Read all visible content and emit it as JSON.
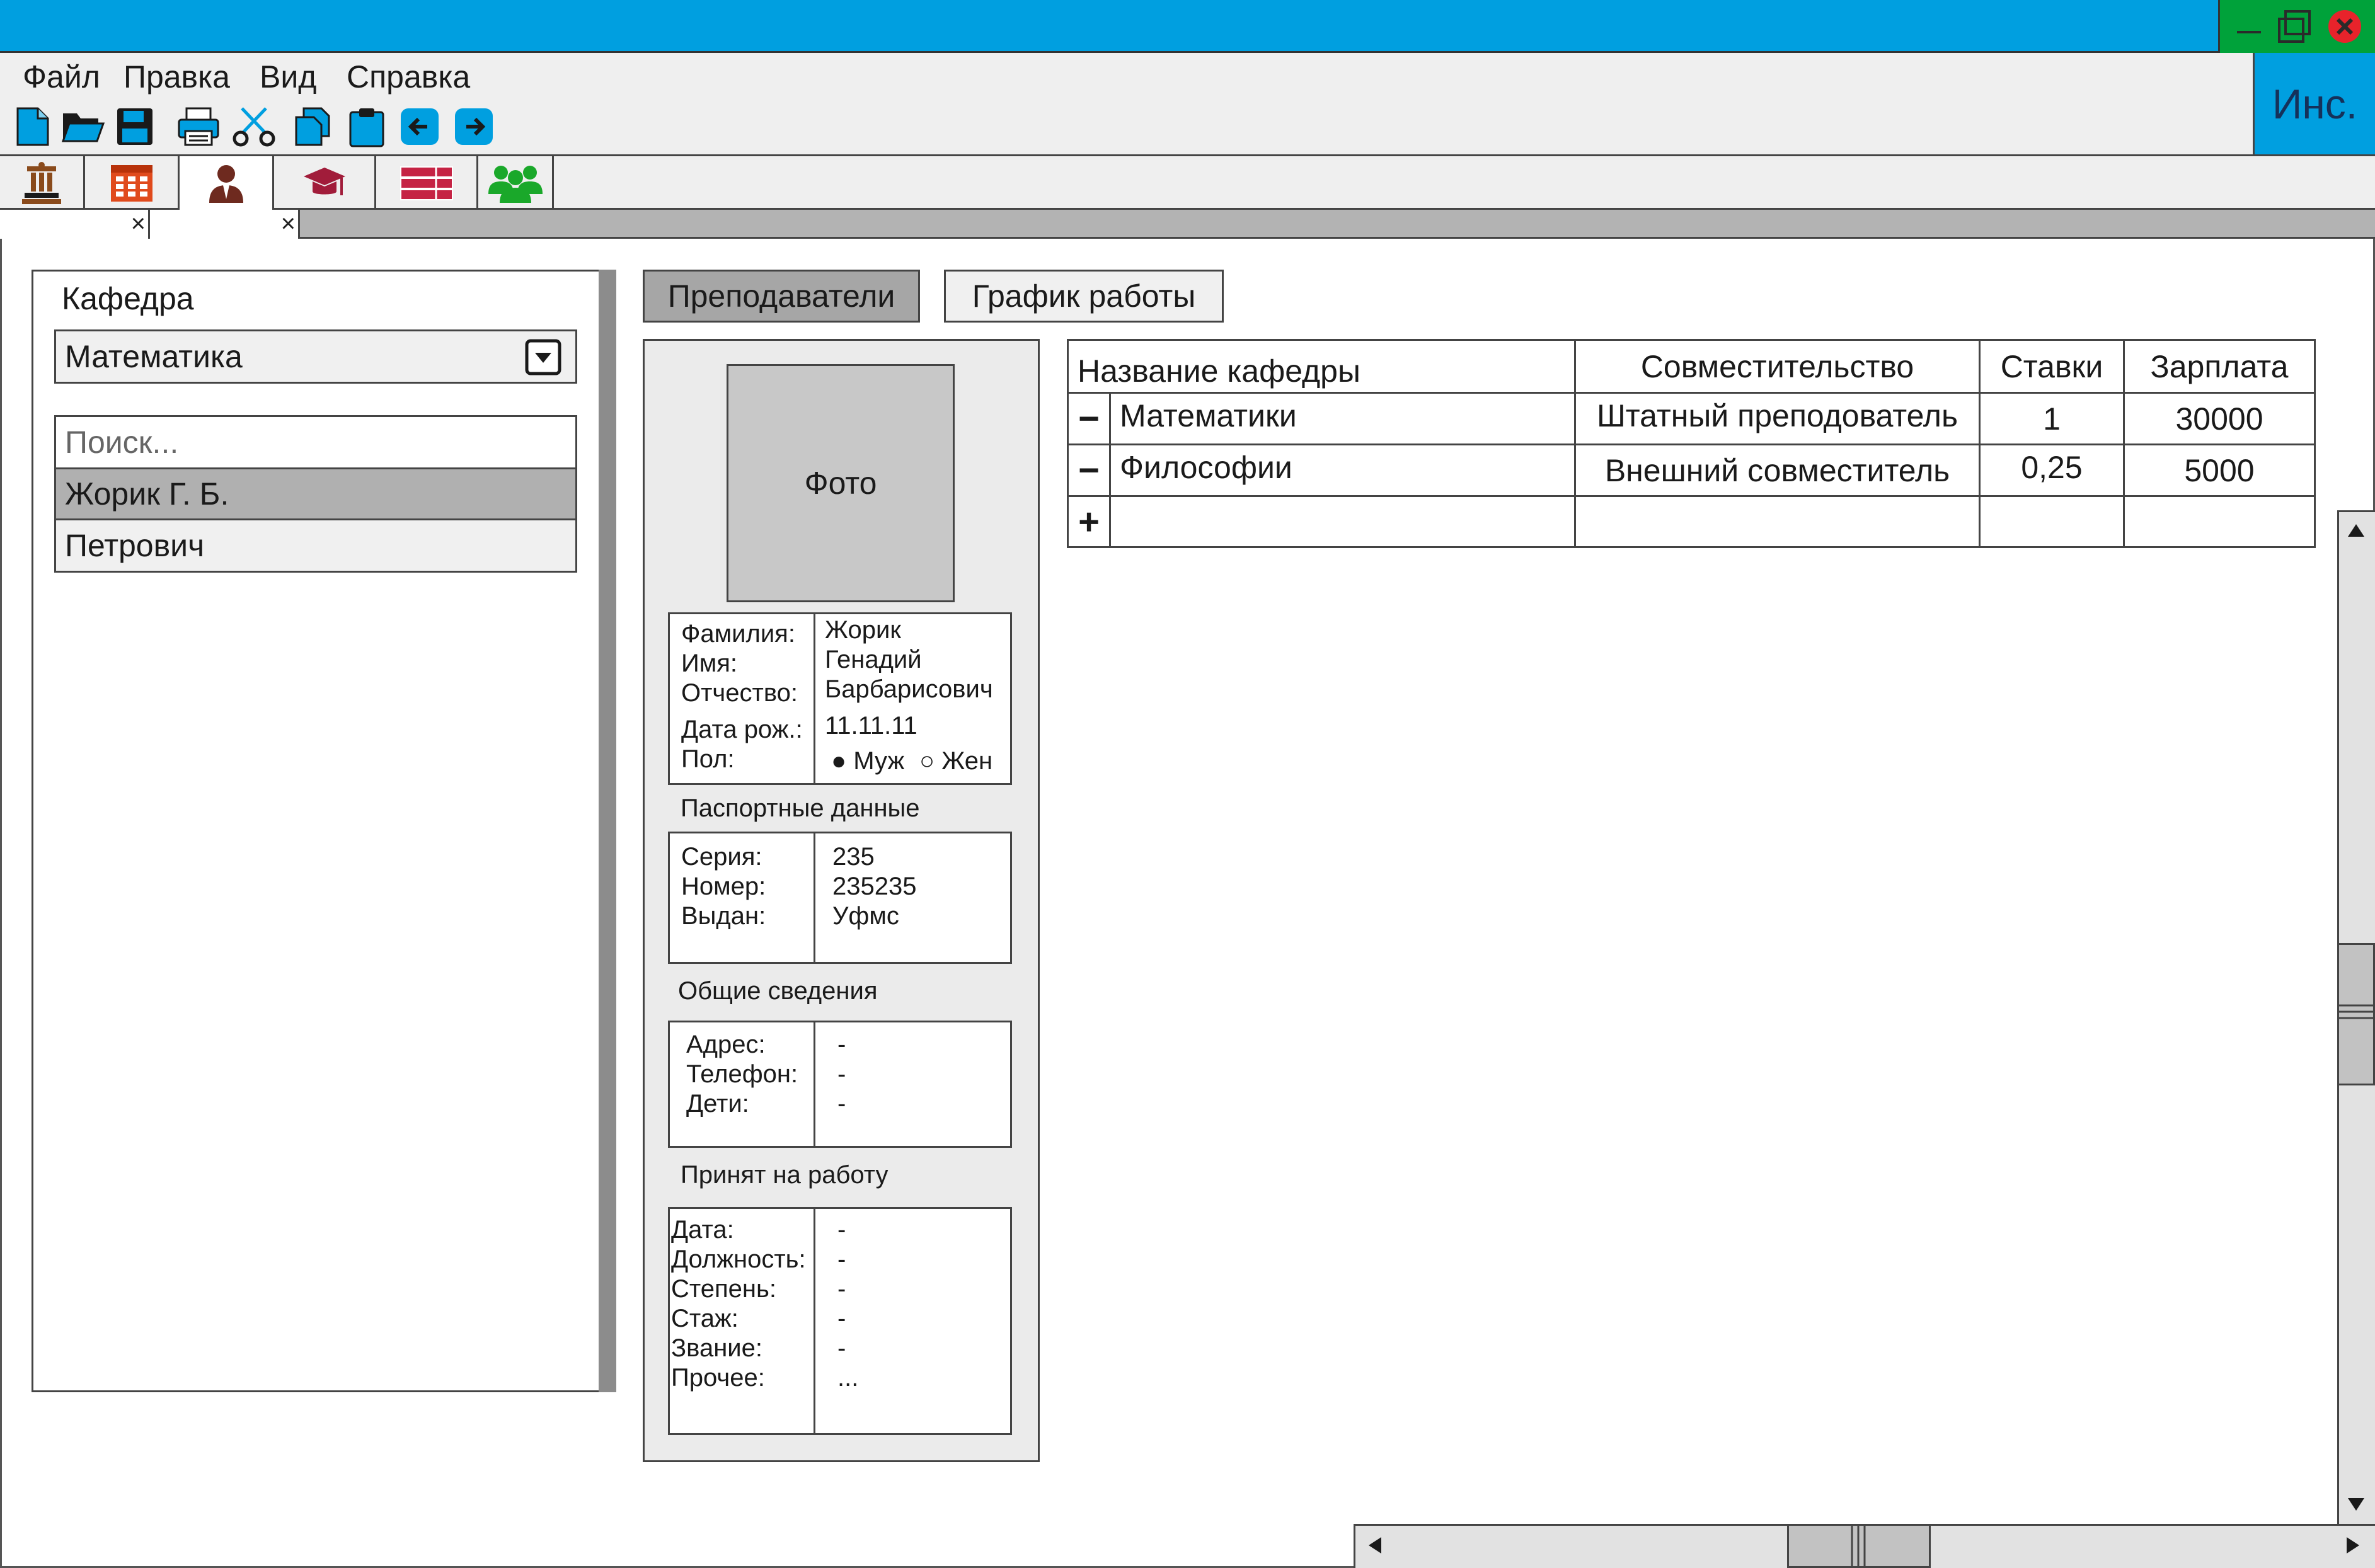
{
  "app": {
    "badge": "Инс.",
    "colors": {
      "titlebar": "#009fe0",
      "window_controls": "#00a23a",
      "close": "#e8232b",
      "accent_icons": "#009fe0"
    }
  },
  "window_controls": {
    "minimize": "minimize-icon",
    "maximize": "maximize-icon",
    "close": "close-icon"
  },
  "menu": [
    "Файл",
    "Правка",
    "Вид",
    "Справка"
  ],
  "toolbar": [
    "new-file-icon",
    "open-folder-icon",
    "save-icon",
    "print-icon",
    "cut-icon",
    "copy-icon",
    "paste-icon",
    "back-arrow-icon",
    "forward-arrow-icon"
  ],
  "module_tabs": [
    "institution-icon",
    "schedule-icon",
    "teacher-icon",
    "graduation-cap-icon",
    "books-icon",
    "group-icon"
  ],
  "doc_tabs": [
    {
      "close": "×"
    },
    {
      "close": "×"
    }
  ],
  "left": {
    "dept_label": "Кафедра",
    "dept_value": "Математика",
    "search_placeholder": "Поиск...",
    "people": [
      "Жорик Г. Б.",
      "Петрович"
    ]
  },
  "tabs": [
    "Преподаватели",
    "График работы"
  ],
  "card": {
    "photo_label": "Фото",
    "personal": {
      "labels": [
        "Фамилия:",
        "Имя:",
        "Отчество:",
        "Дата рож.:",
        "Пол:"
      ],
      "values": [
        "Жорик",
        "Генадий",
        "Барбарисович",
        "11.11.11"
      ],
      "gender": {
        "selected": "Муж",
        "other": "Жен"
      }
    },
    "passport": {
      "title": "Паспортные данные",
      "labels": [
        "Серия:",
        "Номер:",
        "Выдан:"
      ],
      "values": [
        "235",
        "235235",
        "Уфмс"
      ]
    },
    "general": {
      "title": "Общие сведения",
      "labels": [
        "Адрес:",
        "Телефон:",
        "Дети:"
      ],
      "values": [
        "-",
        "-",
        "-"
      ]
    },
    "hired": {
      "title": "Принят на работу",
      "labels": [
        "Дата:",
        "Должность:",
        "Степень:",
        "Стаж:",
        "Звание:",
        "Прочее:"
      ],
      "values": [
        "-",
        "-",
        "-",
        "-",
        "-",
        "..."
      ]
    }
  },
  "table": {
    "headers": [
      "Название кафедры",
      "Совместительство",
      "Ставки",
      "Зарплата"
    ],
    "rows": [
      {
        "sign": "−",
        "dept": "Математики",
        "type": "Штатный преподователь",
        "rate": "1",
        "salary": "30000"
      },
      {
        "sign": "−",
        "dept": "Философии",
        "type": "Внешний совместитель",
        "rate": "0,25",
        "salary": "5000"
      }
    ],
    "add_sign": "+"
  }
}
